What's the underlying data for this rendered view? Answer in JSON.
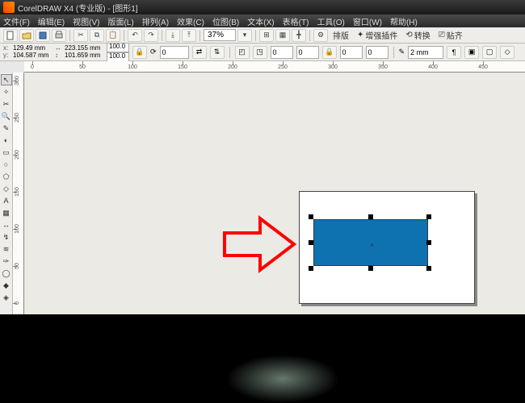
{
  "title": "CorelDRAW X4 (专业版) - [图形1]",
  "menu": [
    "文件(F)",
    "编辑(E)",
    "视图(V)",
    "版面(L)",
    "排列(A)",
    "效果(C)",
    "位图(B)",
    "文本(X)",
    "表格(T)",
    "工具(O)",
    "窗口(W)",
    "帮助(H)"
  ],
  "toolbar": {
    "zoom": "37%",
    "btns_right": [
      "排版",
      "增强插件",
      "转换",
      "贴齐"
    ]
  },
  "propbar": {
    "x_label": "x:",
    "y_label": "y:",
    "x_val": "129.49 mm",
    "y_val": "104.587 mm",
    "w_val": "223.155 mm",
    "h_val": "101.659 mm",
    "scale_x": "100.0",
    "scale_y": "100.0",
    "rotation": "0",
    "outline": "2 mm"
  },
  "ruler_h": [
    0,
    50,
    100,
    150,
    200,
    250,
    300,
    350,
    400,
    450
  ],
  "ruler_v": [
    300,
    250,
    200,
    150,
    100,
    50,
    0
  ],
  "shape": {
    "type": "rectangle",
    "fill": "#0f72b0"
  }
}
